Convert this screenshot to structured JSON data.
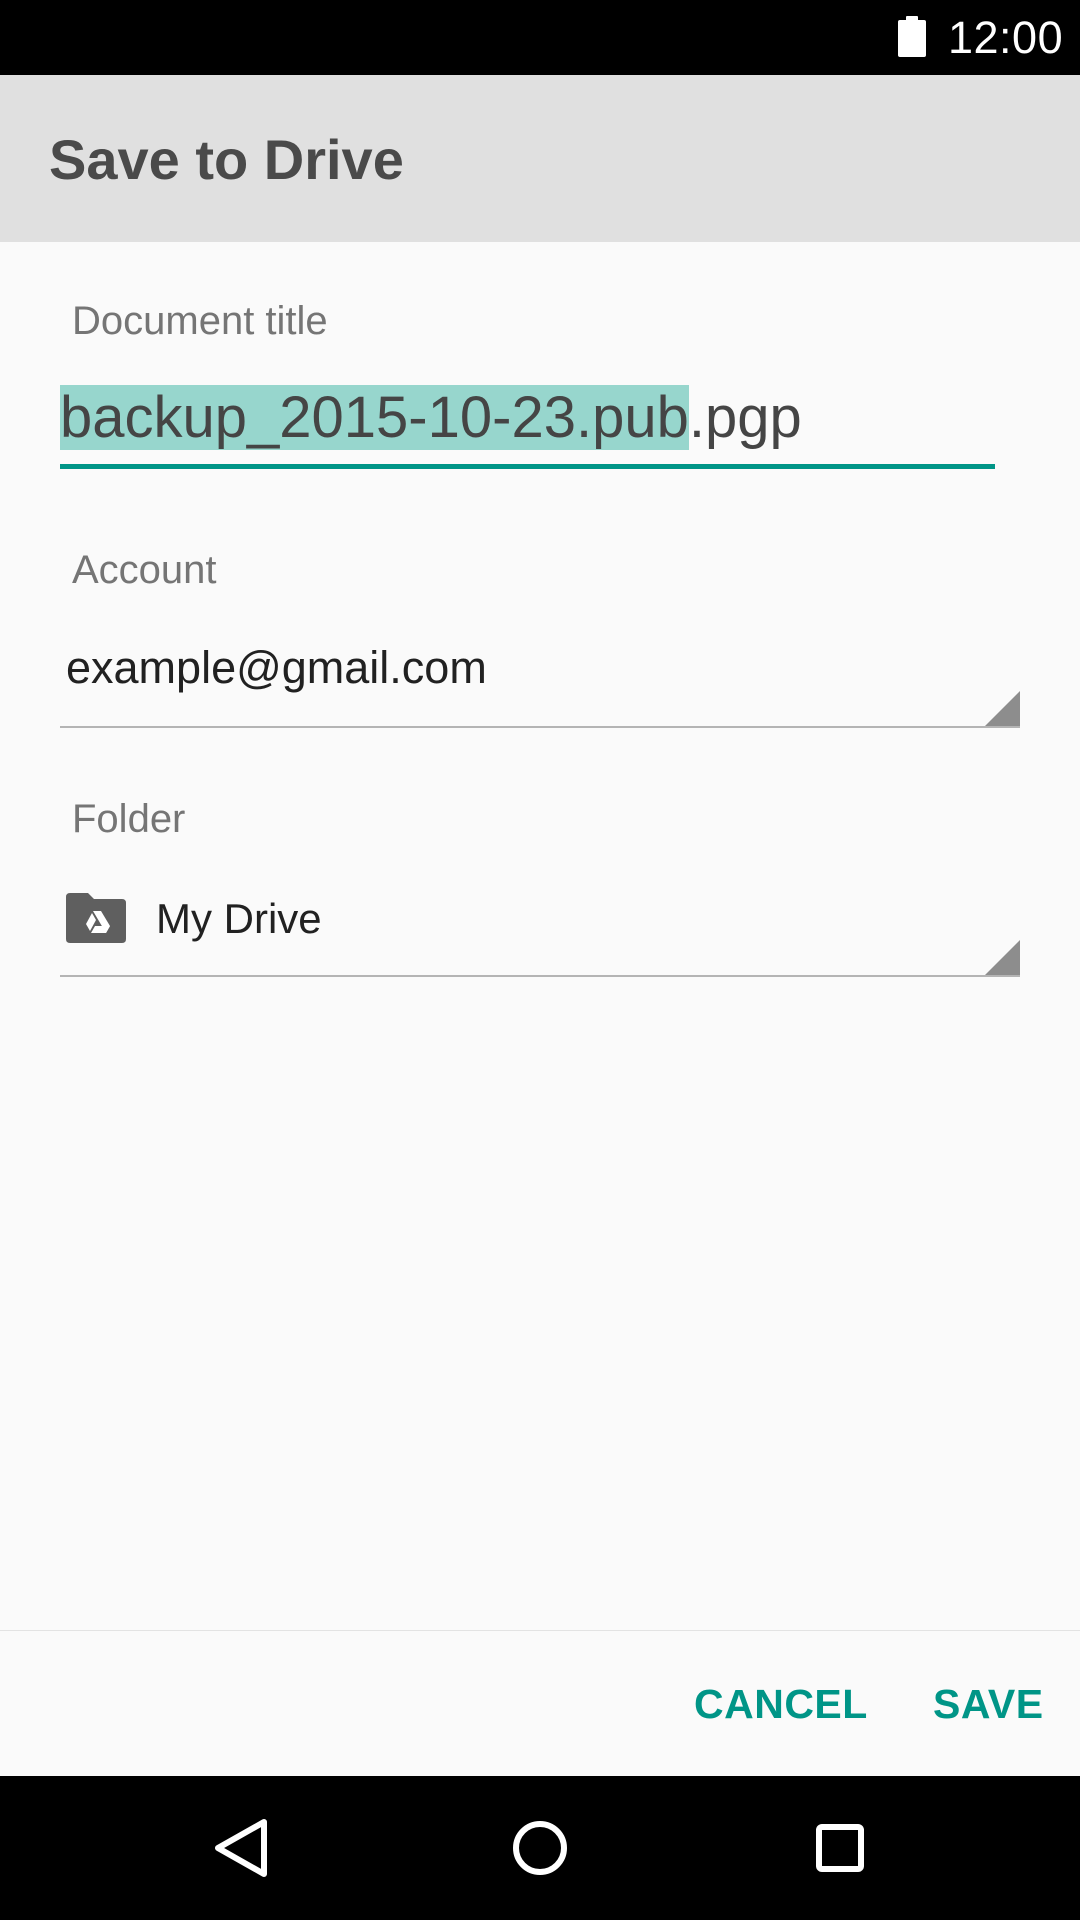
{
  "status_bar": {
    "time": "12:00",
    "battery_icon": "battery-full-icon"
  },
  "dialog": {
    "title": "Save to Drive",
    "document_title": {
      "label": "Document title",
      "value_selected": "backup_2015-10-23.pub",
      "value_rest": ".pgp"
    },
    "account": {
      "label": "Account",
      "value": "example@gmail.com"
    },
    "folder": {
      "label": "Folder",
      "value": "My Drive",
      "icon": "drive-folder-icon"
    },
    "buttons": {
      "cancel": "CANCEL",
      "save": "SAVE"
    }
  },
  "nav_bar": {
    "icons": [
      "back-icon",
      "home-icon",
      "recents-icon"
    ]
  },
  "colors": {
    "accent": "#009587",
    "selection": "#97d6cd",
    "header_bg": "#e0e0e0",
    "body_bg": "#fafafa"
  }
}
